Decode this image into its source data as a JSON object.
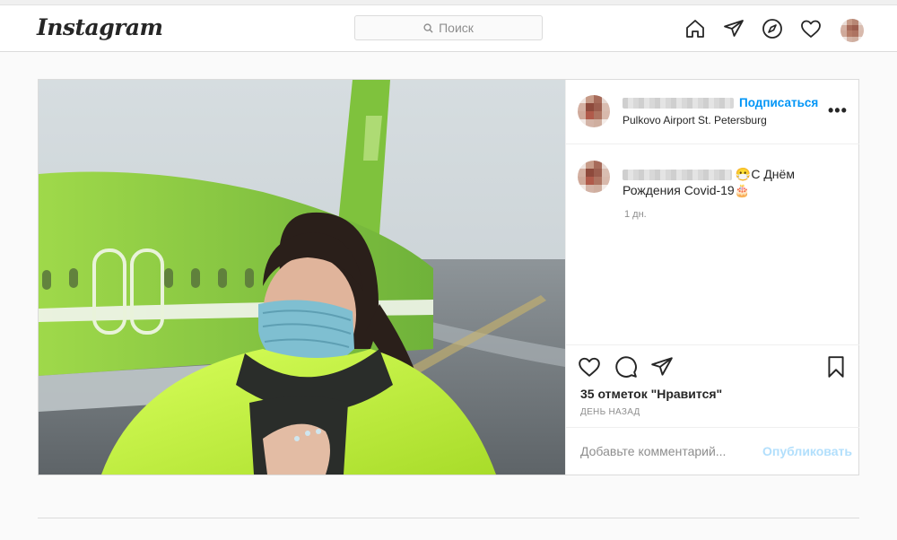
{
  "nav": {
    "logo": "Instagram",
    "search_placeholder": "Поиск",
    "icons": [
      "home-icon",
      "direct-icon",
      "explore-icon",
      "heart-icon",
      "profile-avatar"
    ]
  },
  "post": {
    "header": {
      "follow_label": "Подписаться",
      "location": "Pulkovo Airport St. Petersburg"
    },
    "caption": {
      "emoji_before": "😷",
      "text": "С Днём Рождения Covid-19",
      "emoji_after": "🎂",
      "time": "1 дн."
    },
    "likes_text": "35 отметок \"Нравится\"",
    "date_text": "ДЕНЬ НАЗАД",
    "comment_placeholder": "Добавьте комментарий...",
    "publish_label": "Опубликовать"
  },
  "colors": {
    "accent": "#0095f6",
    "publish_disabled": "#b2dffc",
    "jacket": "#c6f23a",
    "plane": "#8ccf3f"
  }
}
